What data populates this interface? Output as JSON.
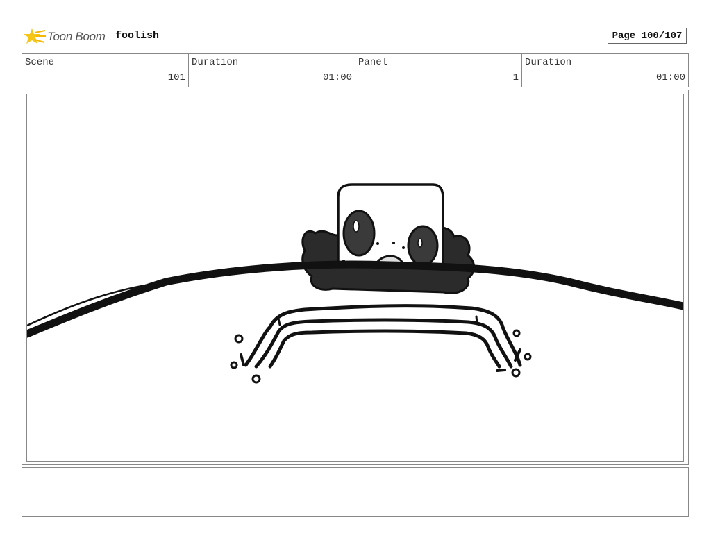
{
  "header": {
    "logo_text": "Toon Boom",
    "project_name": "foolish",
    "page_label": "Page 100/107"
  },
  "info": {
    "scene_label": "Scene",
    "scene_value": "101",
    "scene_duration_label": "Duration",
    "scene_duration_value": "01:00",
    "panel_label": "Panel",
    "panel_value": "1",
    "panel_duration_label": "Duration",
    "panel_duration_value": "01:00"
  },
  "notes": {
    "text": ""
  },
  "colors": {
    "logo_star": "#f5c518",
    "ink": "#111111",
    "hair": "#2b2b2b",
    "border": "#888888"
  }
}
